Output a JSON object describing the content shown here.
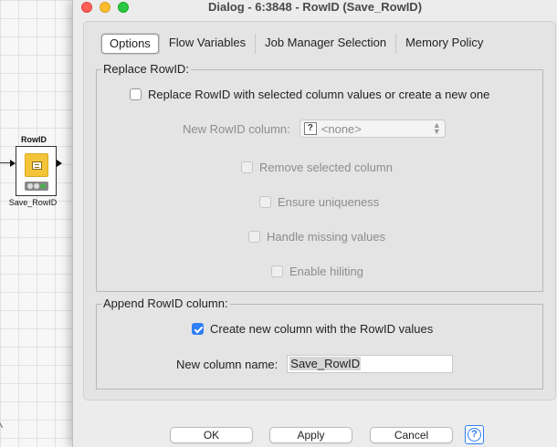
{
  "canvas": {
    "node": {
      "title": "RowID",
      "label": "Save_RowID"
    }
  },
  "window": {
    "title": "Dialog - 6:3848 - RowID (Save_RowID)"
  },
  "tabs": [
    {
      "label": "Options",
      "active": true
    },
    {
      "label": "Flow Variables",
      "active": false
    },
    {
      "label": "Job Manager Selection",
      "active": false
    },
    {
      "label": "Memory Policy",
      "active": false
    }
  ],
  "replace_group": {
    "title": "Replace RowID:",
    "replace_checkbox": {
      "label": "Replace RowID with selected column values or create a new one",
      "checked": false
    },
    "new_rowid_column": {
      "label": "New RowID column:",
      "value": "<none>",
      "icon": "missing-type-icon"
    },
    "remove_selected": {
      "label": "Remove selected column",
      "checked": false,
      "enabled": false
    },
    "ensure_uniqueness": {
      "label": "Ensure uniqueness",
      "checked": false,
      "enabled": false
    },
    "handle_missing": {
      "label": "Handle missing values",
      "checked": false,
      "enabled": false
    },
    "enable_hiliting": {
      "label": "Enable hiliting",
      "checked": false,
      "enabled": false
    }
  },
  "append_group": {
    "title": "Append RowID column:",
    "create_checkbox": {
      "label": "Create new column with the RowID values",
      "checked": true
    },
    "new_column_name": {
      "label": "New column name:",
      "value": "Save_RowID"
    }
  },
  "buttons": {
    "ok": "OK",
    "apply": "Apply",
    "cancel": "Cancel",
    "help_glyph": "?"
  },
  "colors": {
    "accent": "#2f7ef6",
    "node_body": "#f3c43a"
  }
}
